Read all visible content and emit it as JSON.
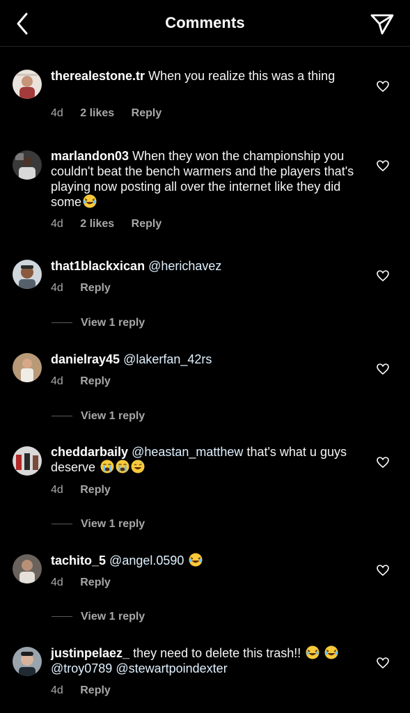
{
  "header": {
    "title": "Comments",
    "back_icon": "chevron-left-icon",
    "send_icon": "paper-plane-icon"
  },
  "comments": [
    {
      "username": "therealestone.tr",
      "text": "When you realize this was a thing",
      "time": "4d",
      "likes": "2 likes",
      "reply": "Reply"
    },
    {
      "username": "marlandon03",
      "text": "When they won the championship you couldn't beat the bench warmers and the players that's playing now posting all over the internet like they did some",
      "time": "4d",
      "likes": "2 likes",
      "reply": "Reply"
    },
    {
      "username": "that1blackxican",
      "mention": "@herichavez",
      "time": "4d",
      "reply": "Reply",
      "view_replies": "View 1 reply"
    },
    {
      "username": "danielray45",
      "mention": "@lakerfan_42rs",
      "time": "4d",
      "reply": "Reply",
      "view_replies": "View 1 reply"
    },
    {
      "username": "cheddarbaily",
      "mention": "@heastan_matthew",
      "text": "that's what u guys deserve",
      "time": "4d",
      "reply": "Reply",
      "view_replies": "View 1 reply"
    },
    {
      "username": "tachito_5",
      "mention": "@angel.0590",
      "time": "4d",
      "reply": "Reply",
      "view_replies": "View 1 reply"
    },
    {
      "username": "justinpelaez_",
      "text": "they need to delete this trash!!",
      "mention": "@troy0789",
      "mention2": "@stewartpoindexter",
      "time": "4d",
      "reply": "Reply"
    }
  ],
  "colors": {
    "background": "#000000",
    "secondary_text": "#a8a8a8",
    "divider": "#262626"
  }
}
